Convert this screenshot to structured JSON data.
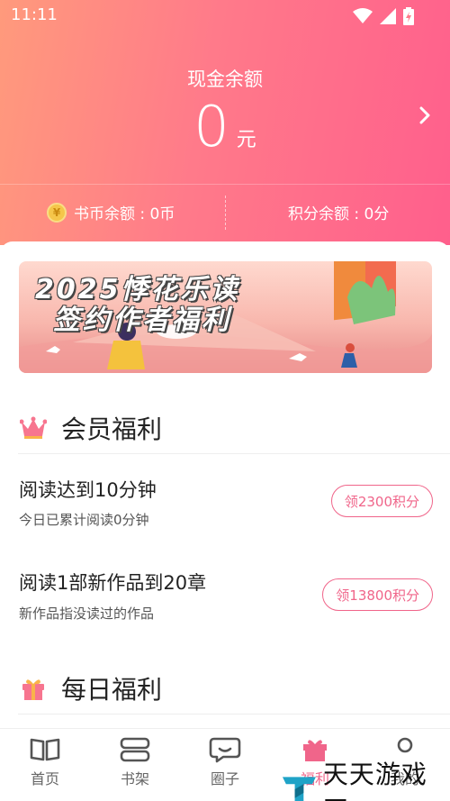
{
  "status_bar": {
    "time": "11:11"
  },
  "wallet": {
    "title": "现金余额",
    "amount": "0",
    "unit": "元",
    "coin_balance": "书币余额 : 0币",
    "points_balance": "积分余额 : 0分"
  },
  "banner": {
    "line1": "2025悸花乐读",
    "line2": "签约作者福利"
  },
  "member_section": {
    "title": "会员福利",
    "tasks": [
      {
        "title": "阅读达到10分钟",
        "desc": "今日已累计阅读0分钟",
        "button": "领2300积分"
      },
      {
        "title": "阅读1部新作品到20章",
        "desc": "新作品指没读过的作品",
        "button": "领13800积分"
      }
    ]
  },
  "daily_section": {
    "title": "每日福利"
  },
  "tabbar": {
    "items": [
      {
        "label": "首页",
        "icon": "book-open-icon"
      },
      {
        "label": "书架",
        "icon": "bookshelf-icon"
      },
      {
        "label": "圈子",
        "icon": "chat-bubble-icon"
      },
      {
        "label": "福利",
        "icon": "gift-icon"
      },
      {
        "label": "我的",
        "icon": "profile-icon"
      }
    ]
  },
  "watermark": {
    "text": "天天游戏网"
  },
  "colors": {
    "accent": "#f0658a",
    "header_start": "#ff9a7c",
    "header_end": "#ff5f8c"
  }
}
